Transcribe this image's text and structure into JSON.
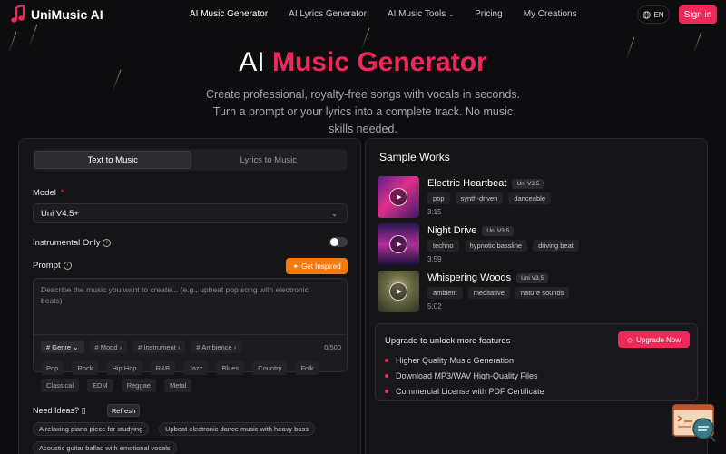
{
  "brand": {
    "name": "UniMusic AI",
    "accent": "#f0285a"
  },
  "nav": {
    "links": [
      "AI Music Generator",
      "AI Lyrics Generator",
      "AI Music Tools",
      "Pricing",
      "My Creations"
    ],
    "lang": "EN",
    "signin": "Sign in"
  },
  "hero": {
    "title_prefix": "AI",
    "title_accent": "Music Generator",
    "subtitle": "Create professional, royalty-free songs with vocals in seconds. Turn a prompt or your lyrics into a complete track. No music skills needed."
  },
  "form": {
    "tabs": [
      "Text to Music",
      "Lyrics to Music"
    ],
    "model_label": "Model",
    "model_required": "*",
    "model_value": "Uni V4.5+",
    "instrumental_label": "Instrumental Only",
    "prompt_label": "Prompt",
    "inspire_label": "Get Inspired",
    "prompt_placeholder": "Describe the music you want to create... (e.g., upbeat pop song with electronic beats)",
    "chips": [
      "# Genre",
      "# Mood",
      "# Instrument",
      "# Ambience"
    ],
    "counter": "0/500",
    "genres": [
      "Pop",
      "Rock",
      "Hip Hop",
      "R&B",
      "Jazz",
      "Blues",
      "Country",
      "Folk",
      "Classical",
      "EDM",
      "Reggae",
      "Metal"
    ],
    "ideas_label": "Need Ideas?",
    "refresh_label": "Refresh",
    "ideas": [
      "A relaxing piano piece for studying",
      "Upbeat electronic dance music with heavy bass",
      "Acoustic guitar ballad with emotional vocals"
    ]
  },
  "samples": {
    "title": "Sample Works",
    "tracks": [
      {
        "title": "Electric Heartbeat",
        "version": "Uni V3.5",
        "tags": [
          "pop",
          "synth-driven",
          "danceable"
        ],
        "duration": "3:15"
      },
      {
        "title": "Night Drive",
        "version": "Uni V3.5",
        "tags": [
          "techno",
          "hypnotic bassline",
          "driving beat"
        ],
        "duration": "3:59"
      },
      {
        "title": "Whispering Woods",
        "version": "Uni V3.5",
        "tags": [
          "ambient",
          "meditative",
          "nature sounds"
        ],
        "duration": "5:02"
      }
    ]
  },
  "upgrade": {
    "title": "Upgrade to unlock more features",
    "button": "Upgrade Now",
    "features": [
      "Higher Quality Music Generation",
      "Download MP3/WAV High-Quality Files",
      "Commercial License with PDF Certificate"
    ]
  }
}
